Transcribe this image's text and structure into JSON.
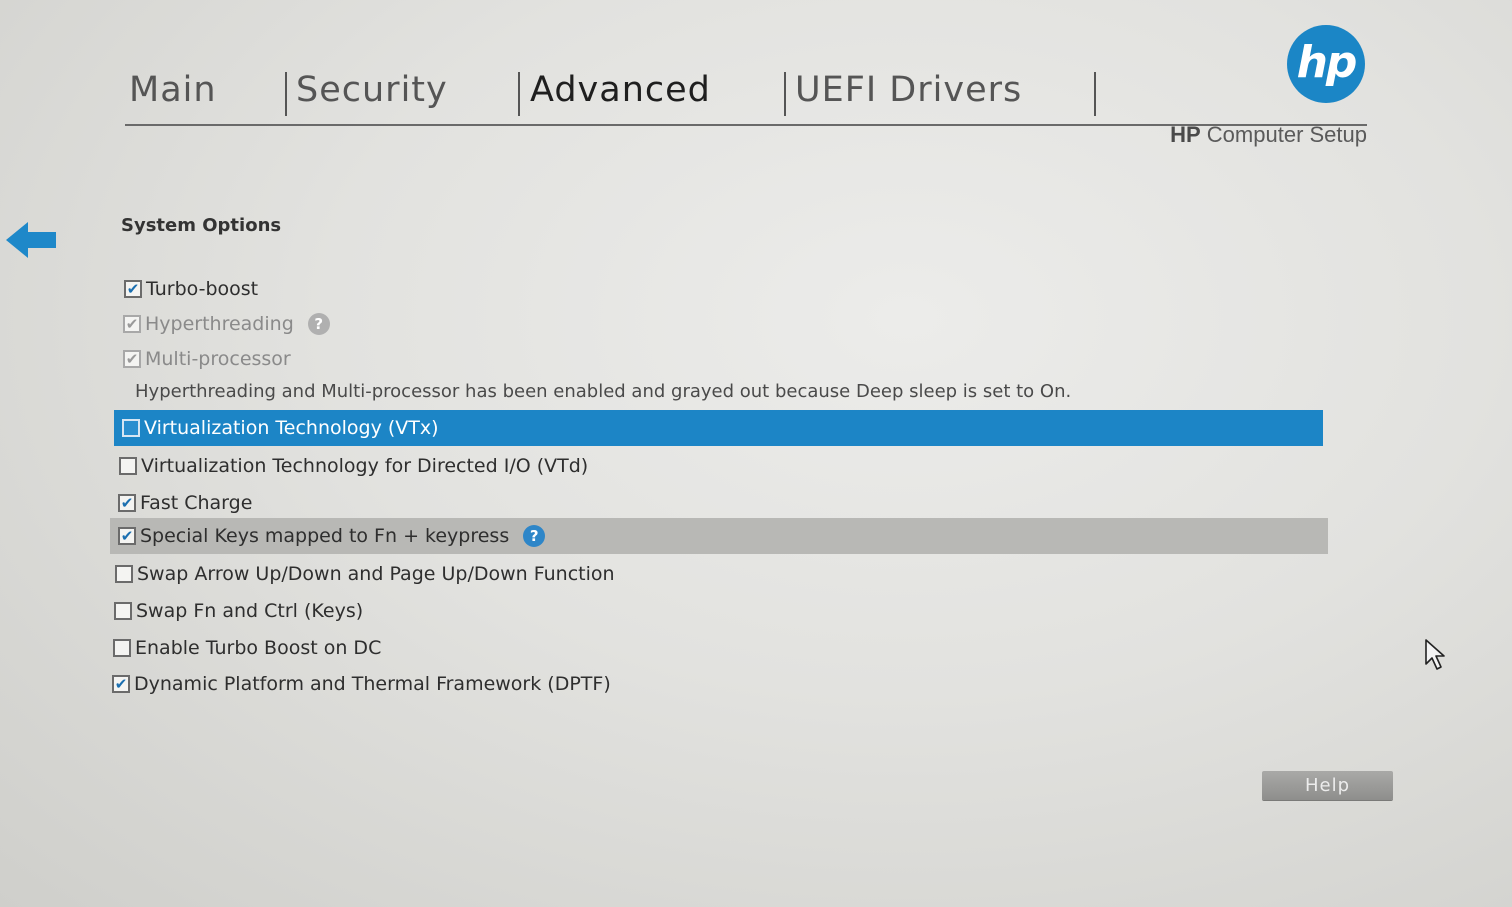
{
  "tabs": [
    {
      "label": "Main",
      "active": false
    },
    {
      "label": "Security",
      "active": false
    },
    {
      "label": "Advanced",
      "active": true
    },
    {
      "label": "UEFI Drivers",
      "active": false
    }
  ],
  "branding": {
    "logo_text": "hp",
    "product_brand": "HP",
    "product_name": "Computer Setup",
    "logo_color": "#1b86c6"
  },
  "section": {
    "title": "System Options"
  },
  "options": [
    {
      "label": "Turbo-boost",
      "checked": true,
      "disabled": false
    },
    {
      "label": "Hyperthreading",
      "checked": true,
      "disabled": true,
      "has_help": true
    },
    {
      "label": "Multi-processor",
      "checked": true,
      "disabled": true
    },
    {
      "label": "Virtualization Technology (VTx)",
      "checked": false,
      "disabled": false,
      "state": "selected"
    },
    {
      "label": "Virtualization Technology for Directed I/O (VTd)",
      "checked": false,
      "disabled": false
    },
    {
      "label": "Fast Charge",
      "checked": true,
      "disabled": false
    },
    {
      "label": "Special Keys mapped to Fn + keypress",
      "checked": true,
      "disabled": false,
      "state": "hover",
      "has_help": true
    },
    {
      "label": "Swap Arrow Up/Down and Page Up/Down Function",
      "checked": false,
      "disabled": false
    },
    {
      "label": "Swap Fn and Ctrl (Keys)",
      "checked": false,
      "disabled": false
    },
    {
      "label": "Enable Turbo Boost on DC",
      "checked": false,
      "disabled": false
    },
    {
      "label": "Dynamic Platform and Thermal Framework (DPTF)",
      "checked": true,
      "disabled": false
    }
  ],
  "note": "Hyperthreading and Multi-processor has been enabled and grayed out because Deep sleep is set to On.",
  "help_glyph": "?",
  "check_glyph": "✔",
  "help_button": {
    "label": "Help"
  },
  "colors": {
    "accent": "#1c85c6",
    "hover_row": "#b8b8b5"
  },
  "icons": {
    "back": "back-arrow-icon",
    "pointer": "mouse-cursor-icon"
  }
}
